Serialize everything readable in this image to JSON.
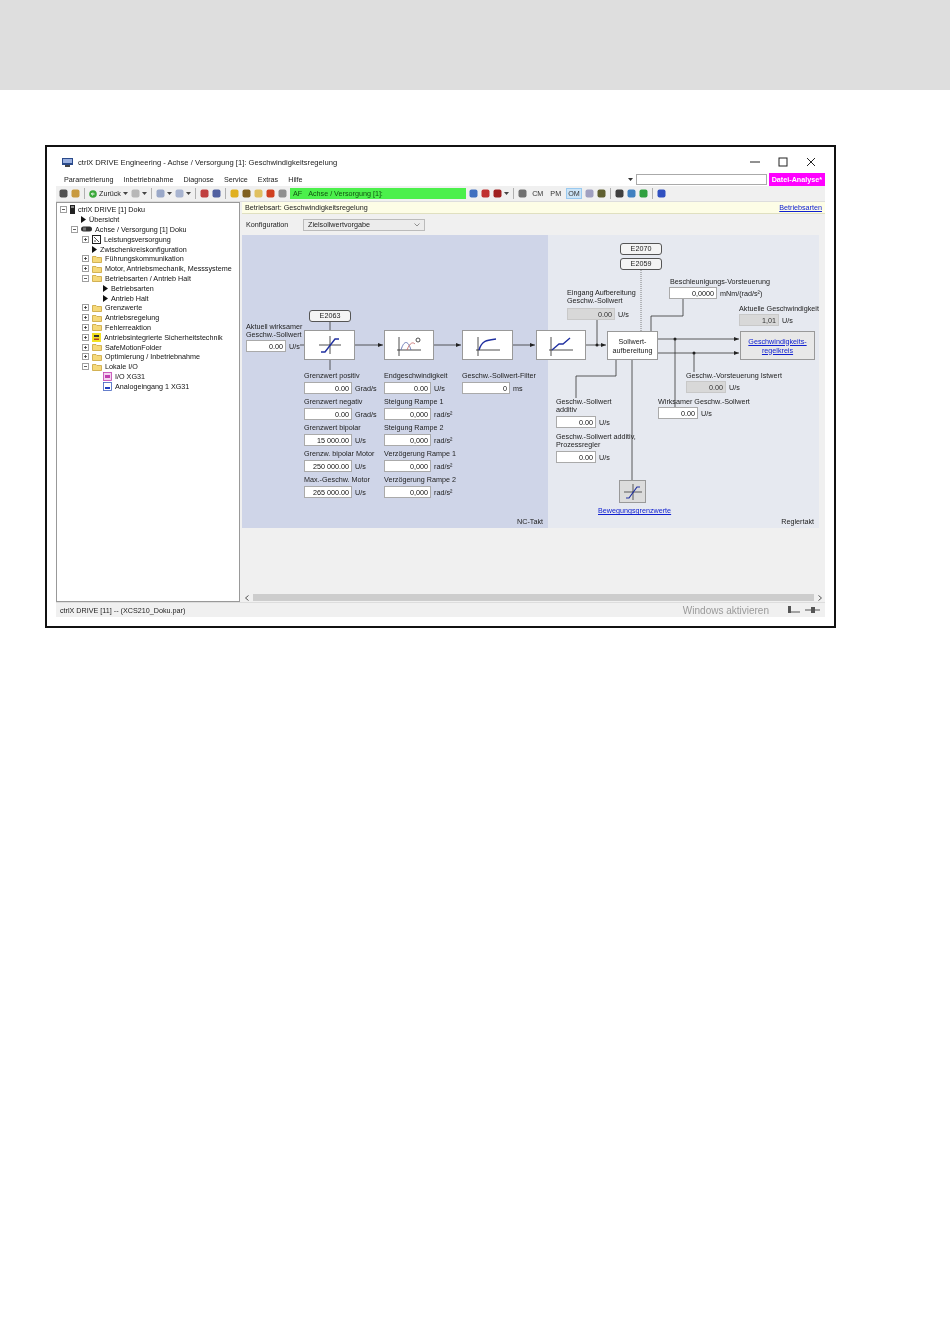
{
  "window": {
    "title": "ctrlX DRIVE Engineering - Achse / Versorgung [1]: Geschwindigkeitsregelung"
  },
  "menu": [
    "Parametrierung",
    "Inbetriebnahme",
    "Diagnose",
    "Service",
    "Extras",
    "Hilfe"
  ],
  "search": {
    "badge": "Datei-Analyse*"
  },
  "toolbar": [
    {
      "kind": "icon",
      "color": "#505050"
    },
    {
      "kind": "icon",
      "color": "#c89a40"
    },
    {
      "kind": "separator"
    },
    {
      "kind": "back",
      "label": "Zurück"
    },
    {
      "kind": "caret"
    },
    {
      "kind": "icon",
      "color": "#b8b8b8"
    },
    {
      "kind": "caret"
    },
    {
      "kind": "separator"
    },
    {
      "kind": "icon",
      "color": "#9aa8c8"
    },
    {
      "kind": "caret"
    },
    {
      "kind": "icon",
      "color": "#a8b4d0"
    },
    {
      "kind": "caret"
    },
    {
      "kind": "separator"
    },
    {
      "kind": "icon",
      "color": "#c04040"
    },
    {
      "kind": "icon",
      "color": "#5060a0"
    },
    {
      "kind": "separator"
    },
    {
      "kind": "icon",
      "color": "#e0b020"
    },
    {
      "kind": "icon",
      "color": "#806020"
    },
    {
      "kind": "icon",
      "color": "#e0c060"
    },
    {
      "kind": "icon",
      "color": "#d04020"
    },
    {
      "kind": "icon",
      "color": "#909090"
    },
    {
      "kind": "status",
      "label": "AF"
    },
    {
      "kind": "status",
      "label": "Achse / Versorgung [1]:"
    },
    {
      "kind": "icon",
      "color": "#4070c0"
    },
    {
      "kind": "icon",
      "color": "#c03030"
    },
    {
      "kind": "icon",
      "color": "#a02020"
    },
    {
      "kind": "caret"
    },
    {
      "kind": "separator"
    },
    {
      "kind": "icon",
      "color": "#707070"
    },
    {
      "kind": "text",
      "label": "CM",
      "selected": false
    },
    {
      "kind": "text",
      "label": "PM",
      "selected": false
    },
    {
      "kind": "text",
      "label": "OM",
      "selected": true
    },
    {
      "kind": "icon",
      "color": "#a0a0c0"
    },
    {
      "kind": "icon",
      "color": "#606030"
    },
    {
      "kind": "separator"
    },
    {
      "kind": "icon",
      "color": "#404040"
    },
    {
      "kind": "icon",
      "color": "#4080c0"
    },
    {
      "kind": "icon",
      "color": "#30a040"
    },
    {
      "kind": "separator"
    },
    {
      "kind": "icon",
      "color": "#3050c0"
    }
  ],
  "tree": {
    "items": [
      {
        "label": "ctrlX DRIVE [1] Doku",
        "kind": "device",
        "expanded": true,
        "children": [
          {
            "label": "Übersicht",
            "kind": "arrow"
          },
          {
            "label": "Achse / Versorgung [1] Doku",
            "kind": "axis",
            "expanded": true,
            "children": [
              {
                "label": "Leistungsversorgung",
                "kind": "power",
                "expanded": false
              },
              {
                "label": "Zwischenkreiskonfiguration",
                "kind": "arrow"
              },
              {
                "label": "Führungskommunikation",
                "kind": "folder",
                "expanded": false
              },
              {
                "label": "Motor, Antriebsmechanik, Messsysteme",
                "kind": "folder",
                "expanded": false
              },
              {
                "label": "Betriebsarten / Antrieb Halt",
                "kind": "folder",
                "expanded": true,
                "children": [
                  {
                    "label": "Betriebsarten",
                    "kind": "arrow"
                  },
                  {
                    "label": "Antrieb Halt",
                    "kind": "arrow"
                  }
                ]
              },
              {
                "label": "Grenzwerte",
                "kind": "folder",
                "expanded": false
              },
              {
                "label": "Antriebsregelung",
                "kind": "folder",
                "expanded": false
              },
              {
                "label": "Fehlerreaktion",
                "kind": "folder",
                "expanded": false
              },
              {
                "label": "Antriebsintegrierte Sicherheitstechnik",
                "kind": "safety",
                "expanded": false
              },
              {
                "label": "SafeMotionFolder",
                "kind": "folder",
                "expanded": false
              },
              {
                "label": "Optimierung / Inbetriebnahme",
                "kind": "folder",
                "expanded": false
              },
              {
                "label": "Lokale I/O",
                "kind": "folder",
                "expanded": true,
                "children": [
                  {
                    "label": "I/O XG31",
                    "kind": "io"
                  },
                  {
                    "label": "Analogeingang 1 XG31",
                    "kind": "analog"
                  }
                ]
              }
            ]
          }
        ]
      }
    ]
  },
  "header": {
    "title": "Betriebsart: Geschwindigkeitsregelung",
    "link": "Betriebsarten"
  },
  "configuration": {
    "label": "Konfiguration",
    "value": "Zielsollwertvorgabe"
  },
  "zones": [
    {
      "label": "NC-Takt"
    },
    {
      "label": "Reglertakt"
    }
  ],
  "tags": [
    {
      "label": "E2063"
    },
    {
      "label": "E2070"
    },
    {
      "label": "E2059"
    }
  ],
  "blocks": [
    {
      "kind": "limiter"
    },
    {
      "kind": "ramp"
    },
    {
      "kind": "filter"
    },
    {
      "kind": "rate"
    },
    {
      "kind": "text",
      "label": "Sollwert-aufbereitung"
    },
    {
      "kind": "link",
      "label": "Geschwindigkeits-regelkreis"
    },
    {
      "kind": "limits"
    }
  ],
  "limits_link": "Bewegungsgrenzwerte",
  "fields": [
    {
      "label": "Aktuell wirksamer Geschw.-Sollwert",
      "value": "0.00",
      "unit": "U/s",
      "readonly": false
    },
    {
      "label": "Grenzwert positiv",
      "value": "0.00",
      "unit": "Grad/s",
      "readonly": false
    },
    {
      "label": "Grenzwert negativ",
      "value": "0.00",
      "unit": "Grad/s",
      "readonly": false
    },
    {
      "label": "Grenzwert bipolar",
      "value": "15 000.00",
      "unit": "U/s",
      "readonly": false
    },
    {
      "label": "Grenzw. bipolar Motor",
      "value": "250 000.00",
      "unit": "U/s",
      "readonly": false
    },
    {
      "label": "Max.-Geschw. Motor",
      "value": "265 000.00",
      "unit": "U/s",
      "readonly": false
    },
    {
      "label": "Endgeschwindigkeit",
      "value": "0.00",
      "unit": "U/s",
      "readonly": false
    },
    {
      "label": "Steigung Rampe 1",
      "value": "0,000",
      "unit": "rad/s²",
      "readonly": false
    },
    {
      "label": "Steigung Rampe 2",
      "value": "0,000",
      "unit": "rad/s²",
      "readonly": false
    },
    {
      "label": "Verzögerung Rampe 1",
      "value": "0,000",
      "unit": "rad/s²",
      "readonly": false
    },
    {
      "label": "Verzögerung Rampe 2",
      "value": "0,000",
      "unit": "rad/s²",
      "readonly": false
    },
    {
      "label": "Geschw.-Sollwert-Filter",
      "value": "0",
      "unit": "ms",
      "readonly": false
    },
    {
      "label": "Eingang Aufbereitung Geschw.-Sollwert",
      "value": "0.00",
      "unit": "U/s",
      "readonly": true
    },
    {
      "label": "Beschleunigungs-Vorsteuerung",
      "value": "0,0000",
      "unit": "mNm/(rad/s²)",
      "readonly": false
    },
    {
      "label": "Aktuelle Geschwindigkeit",
      "value": "1,01",
      "unit": "U/s",
      "readonly": true
    },
    {
      "label": "Geschw.-Vorsteuerung Istwert",
      "value": "0.00",
      "unit": "U/s",
      "readonly": true
    },
    {
      "label": "Geschw.-Sollwert additiv",
      "value": "0.00",
      "unit": "U/s",
      "readonly": false
    },
    {
      "label": "Wirksamer Geschw.-Sollwert",
      "value": "0.00",
      "unit": "U/s",
      "readonly": false
    },
    {
      "label": "Geschw.-Sollwert additiv, Prozessregler",
      "value": "0.00",
      "unit": "U/s",
      "readonly": false
    }
  ],
  "status_bar": {
    "text": "ctrlX DRIVE [11] -- (XCS210_Doku.par)",
    "overlay": "Windows aktivieren"
  }
}
